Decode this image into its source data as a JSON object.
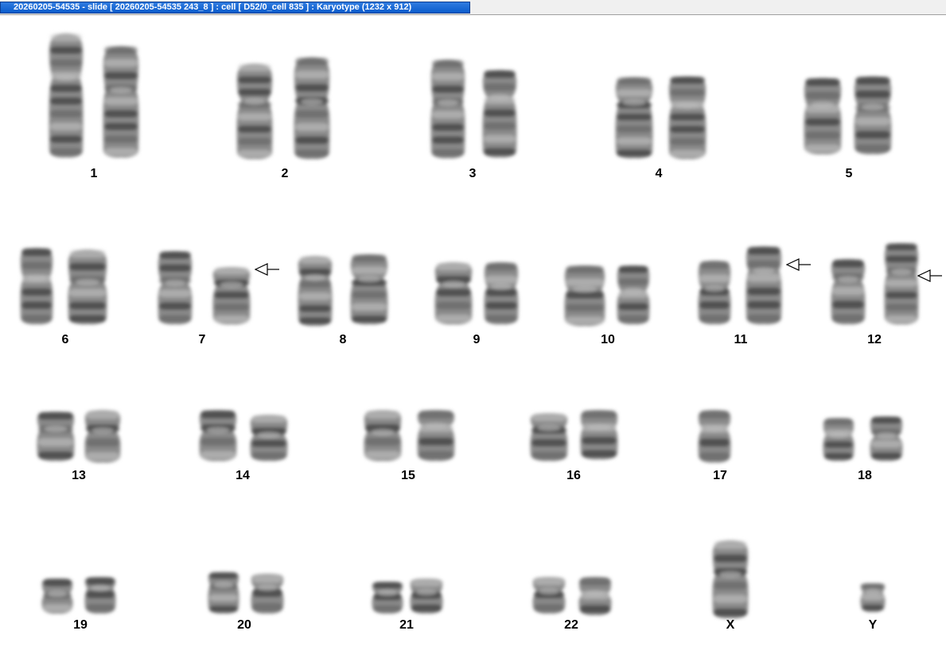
{
  "window": {
    "title": "20260205-54535 - slide [ 20260205-54535 243_8 ] : cell [ D52/0_cell 835 ] : Karyotype  (1232 x 912)"
  },
  "karyotype": {
    "chromosomes": [
      {
        "id": "1",
        "label": "1",
        "arrow": false
      },
      {
        "id": "2",
        "label": "2",
        "arrow": false
      },
      {
        "id": "3",
        "label": "3",
        "arrow": false
      },
      {
        "id": "4",
        "label": "4",
        "arrow": false
      },
      {
        "id": "5",
        "label": "5",
        "arrow": false
      },
      {
        "id": "6",
        "label": "6",
        "arrow": false
      },
      {
        "id": "7",
        "label": "7",
        "arrow": true
      },
      {
        "id": "8",
        "label": "8",
        "arrow": false
      },
      {
        "id": "9",
        "label": "9",
        "arrow": false
      },
      {
        "id": "10",
        "label": "10",
        "arrow": false
      },
      {
        "id": "11",
        "label": "11",
        "arrow": true
      },
      {
        "id": "12",
        "label": "12",
        "arrow": true
      },
      {
        "id": "13",
        "label": "13",
        "arrow": false
      },
      {
        "id": "14",
        "label": "14",
        "arrow": false
      },
      {
        "id": "15",
        "label": "15",
        "arrow": false
      },
      {
        "id": "16",
        "label": "16",
        "arrow": false
      },
      {
        "id": "17",
        "label": "17",
        "arrow": false
      },
      {
        "id": "18",
        "label": "18",
        "arrow": false
      },
      {
        "id": "19",
        "label": "19",
        "arrow": false
      },
      {
        "id": "20",
        "label": "20",
        "arrow": false
      },
      {
        "id": "21",
        "label": "21",
        "arrow": false
      },
      {
        "id": "22",
        "label": "22",
        "arrow": false
      },
      {
        "id": "X",
        "label": "X",
        "arrow": false
      },
      {
        "id": "Y",
        "label": "Y",
        "arrow": false
      }
    ]
  }
}
